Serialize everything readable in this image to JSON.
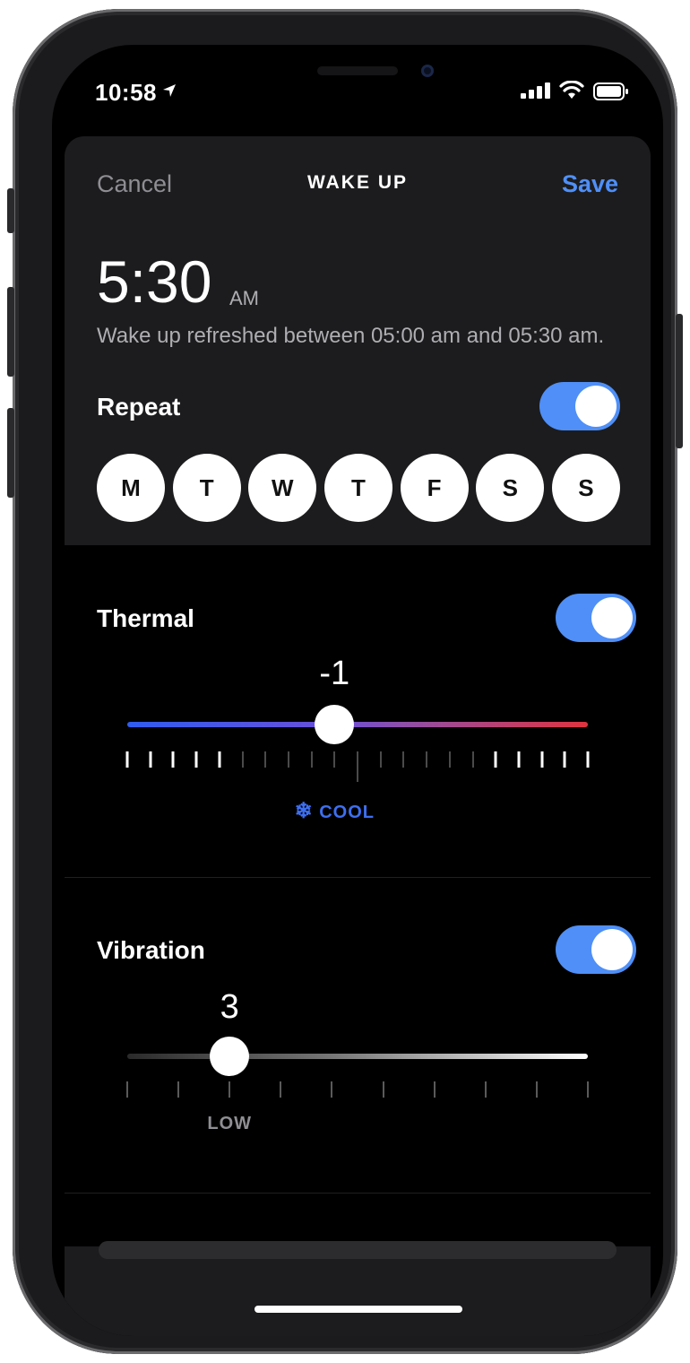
{
  "status_bar": {
    "time": "10:58"
  },
  "header": {
    "cancel_label": "Cancel",
    "title": "WAKE UP",
    "save_label": "Save"
  },
  "alarm": {
    "time": "5:30",
    "period": "AM",
    "description": "Wake up refreshed between 05:00 am and 05:30 am."
  },
  "repeat": {
    "label": "Repeat",
    "enabled": true,
    "days": [
      "M",
      "T",
      "W",
      "T",
      "F",
      "S",
      "S"
    ]
  },
  "thermal": {
    "label": "Thermal",
    "enabled": true,
    "value": "-1",
    "min": -10,
    "max": 10,
    "current": -1,
    "mode_label": "COOL",
    "mode_color": "#3d6ff0"
  },
  "vibration": {
    "label": "Vibration",
    "enabled": true,
    "value": "3",
    "min": 1,
    "max": 10,
    "current": 3,
    "level_label": "LOW"
  },
  "colors": {
    "accent": "#4f8ff7",
    "cool": "#2f5cf0",
    "warm": "#e0343f"
  }
}
